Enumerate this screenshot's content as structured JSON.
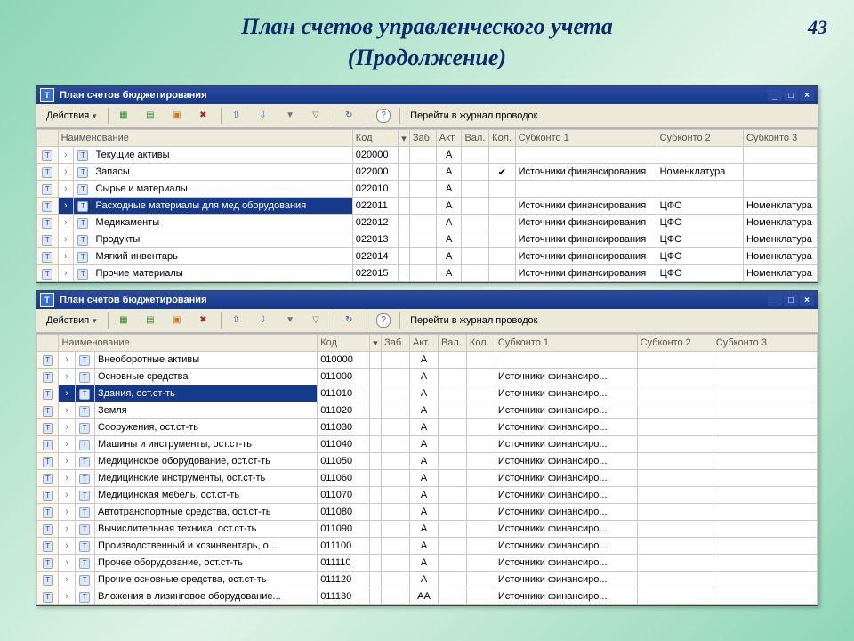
{
  "slide": {
    "number": "43",
    "title_line1": "План счетов управленческого учета",
    "title_line2": "(Продолжение)"
  },
  "common": {
    "window_title": "План счетов бюджетирования",
    "actions_label": "Действия",
    "link_label": "Перейти в журнал проводок",
    "minimize": "_",
    "maximize": "□",
    "close": "×",
    "help": "?"
  },
  "headers": {
    "blank": "",
    "name": "Наименование",
    "code": "Код",
    "zab": "Заб.",
    "akt": "Акт.",
    "val": "Вал.",
    "kol": "Кол.",
    "sub1": "Субконто 1",
    "sub2": "Субконто 2",
    "sub3": "Субконто 3"
  },
  "window1": {
    "col_widths": {
      "rowic": 16,
      "arrow": 10,
      "ic2": 14,
      "name": 285,
      "code": 50,
      "sort": 10,
      "zab": 28,
      "akt": 28,
      "val": 28,
      "kol": 28,
      "sub1": 155,
      "sub2": 95,
      "sub3": 78
    },
    "rows": [
      {
        "name": "Текущие активы",
        "code": "020000",
        "akt": "А",
        "kol": "",
        "sub1": "",
        "sub2": "",
        "sub3": "",
        "sel": false
      },
      {
        "name": "Запасы",
        "code": "022000",
        "akt": "А",
        "kol": "✔",
        "sub1": "Источники финансирования",
        "sub2": "Номенклатура",
        "sub3": "",
        "sel": false
      },
      {
        "name": "Сырье и материалы",
        "code": "022010",
        "akt": "А",
        "kol": "",
        "sub1": "",
        "sub2": "",
        "sub3": "",
        "sel": false
      },
      {
        "name": "Расходные материалы для мед оборудования",
        "code": "022011",
        "akt": "А",
        "kol": "",
        "sub1": "Источники финансирования",
        "sub2": "ЦФО",
        "sub3": "Номенклатура",
        "sel": true
      },
      {
        "name": "Медикаменты",
        "code": "022012",
        "akt": "А",
        "kol": "",
        "sub1": "Источники финансирования",
        "sub2": "ЦФО",
        "sub3": "Номенклатура",
        "sel": false
      },
      {
        "name": "Продукты",
        "code": "022013",
        "akt": "А",
        "kol": "",
        "sub1": "Источники финансирования",
        "sub2": "ЦФО",
        "sub3": "Номенклатура",
        "sel": false
      },
      {
        "name": "Мягкий инвентарь",
        "code": "022014",
        "akt": "А",
        "kol": "",
        "sub1": "Источники финансирования",
        "sub2": "ЦФО",
        "sub3": "Номенклатура",
        "sel": false
      },
      {
        "name": "Прочие материалы",
        "code": "022015",
        "akt": "А",
        "kol": "",
        "sub1": "Источники финансирования",
        "sub2": "ЦФО",
        "sub3": "Номенклатура",
        "sel": false
      }
    ]
  },
  "window2": {
    "col_widths": {
      "rowic": 16,
      "arrow": 10,
      "ic2": 14,
      "name": 235,
      "code": 55,
      "sort": 10,
      "zab": 30,
      "akt": 30,
      "val": 30,
      "kol": 30,
      "sub1": 150,
      "sub2": 80,
      "sub3": 110
    },
    "rows": [
      {
        "name": "Внеоборотные активы",
        "code": "010000",
        "akt": "А",
        "sub1": "",
        "sel": false
      },
      {
        "name": "Основные средства",
        "code": "011000",
        "akt": "А",
        "sub1": "Источники финансиро...",
        "sel": false
      },
      {
        "name": "Здания, ост.ст-ть",
        "code": "011010",
        "akt": "А",
        "sub1": "Источники финансиро...",
        "sel": true
      },
      {
        "name": "Земля",
        "code": "011020",
        "akt": "А",
        "sub1": "Источники финансиро...",
        "sel": false
      },
      {
        "name": "Сооружения, ост.ст-ть",
        "code": "011030",
        "akt": "А",
        "sub1": "Источники финансиро...",
        "sel": false
      },
      {
        "name": "Машины и инструменты, ост.ст-ть",
        "code": "011040",
        "akt": "А",
        "sub1": "Источники финансиро...",
        "sel": false
      },
      {
        "name": "Медицинское оборудование, ост.ст-ть",
        "code": "011050",
        "akt": "А",
        "sub1": "Источники финансиро...",
        "sel": false
      },
      {
        "name": "Медицинские инструменты, ост.ст-ть",
        "code": "011060",
        "akt": "А",
        "sub1": "Источники финансиро...",
        "sel": false
      },
      {
        "name": "Медицинская мебель, ост.ст-ть",
        "code": "011070",
        "akt": "А",
        "sub1": "Источники финансиро...",
        "sel": false
      },
      {
        "name": "Автотранспортные средства, ост.ст-ть",
        "code": "011080",
        "akt": "А",
        "sub1": "Источники финансиро...",
        "sel": false
      },
      {
        "name": "Вычислительная техника, ост.ст-ть",
        "code": "011090",
        "akt": "А",
        "sub1": "Источники финансиро...",
        "sel": false
      },
      {
        "name": "Производственный и хозинвентарь, о...",
        "code": "011100",
        "akt": "А",
        "sub1": "Источники финансиро...",
        "sel": false
      },
      {
        "name": "Прочее оборудование, ост.ст-ть",
        "code": "011110",
        "akt": "А",
        "sub1": "Источники финансиро...",
        "sel": false
      },
      {
        "name": "Прочие основные средства, ост.ст-ть",
        "code": "011120",
        "akt": "А",
        "sub1": "Источники финансиро...",
        "sel": false
      },
      {
        "name": "Вложения в лизинговое оборудование...",
        "code": "011130",
        "akt": "АА",
        "sub1": "Источники финансиро...",
        "sel": false
      }
    ]
  }
}
